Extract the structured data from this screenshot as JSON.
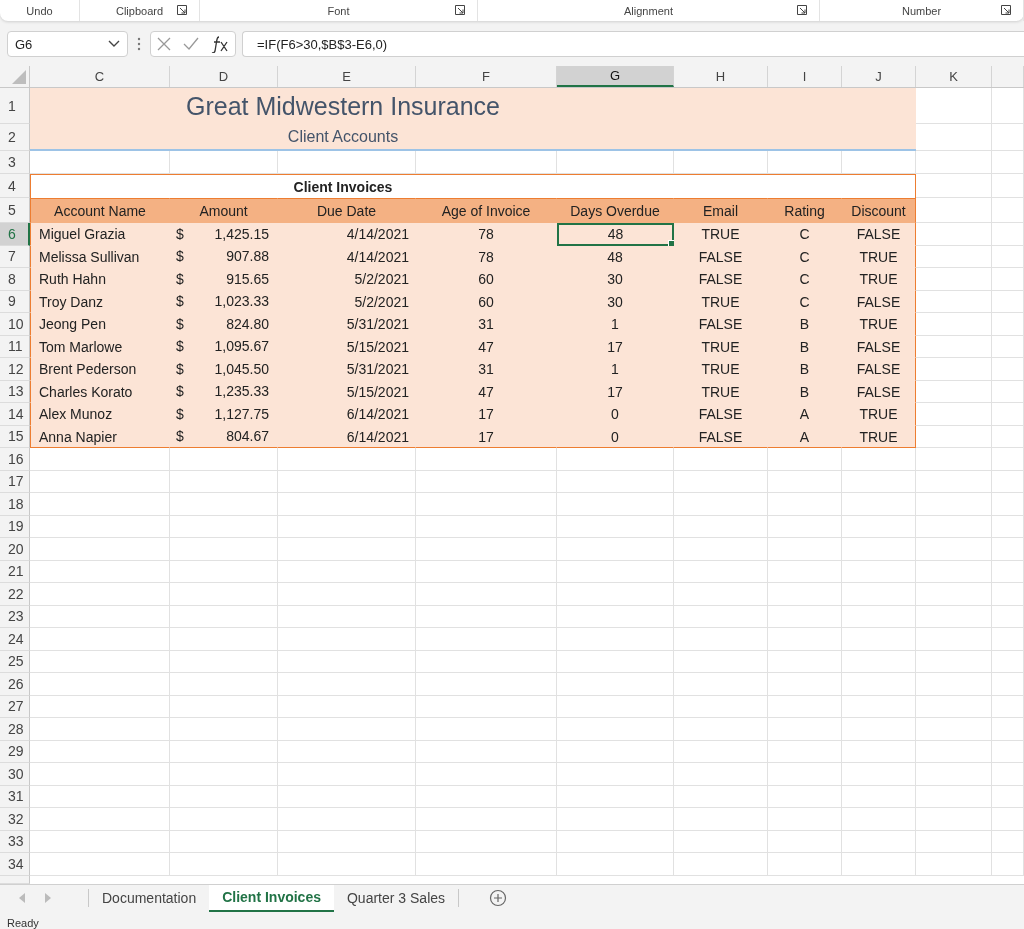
{
  "ribbon_groups": [
    {
      "label": "Undo",
      "launcher": false
    },
    {
      "label": "Clipboard",
      "launcher": true
    },
    {
      "label": "Font",
      "launcher": true
    },
    {
      "label": "Alignment",
      "launcher": true
    },
    {
      "label": "Number",
      "launcher": true
    }
  ],
  "name_box": "G6",
  "formula": "=IF(F6>30,$B$3-E6,0)",
  "columns": [
    {
      "label": "C",
      "selected": false
    },
    {
      "label": "D",
      "selected": false
    },
    {
      "label": "E",
      "selected": false
    },
    {
      "label": "F",
      "selected": false
    },
    {
      "label": "G",
      "selected": true
    },
    {
      "label": "H",
      "selected": false
    },
    {
      "label": "I",
      "selected": false
    },
    {
      "label": "J",
      "selected": false
    },
    {
      "label": "K",
      "selected": false
    }
  ],
  "row_numbers": [
    {
      "label": "1",
      "selected": false
    },
    {
      "label": "2",
      "selected": false
    },
    {
      "label": "3",
      "selected": false
    },
    {
      "label": "4",
      "selected": false
    },
    {
      "label": "5",
      "selected": false
    },
    {
      "label": "6",
      "selected": true
    },
    {
      "label": "7",
      "selected": false
    },
    {
      "label": "8",
      "selected": false
    },
    {
      "label": "9",
      "selected": false
    },
    {
      "label": "10",
      "selected": false
    },
    {
      "label": "11",
      "selected": false
    },
    {
      "label": "12",
      "selected": false
    },
    {
      "label": "13",
      "selected": false
    },
    {
      "label": "14",
      "selected": false
    },
    {
      "label": "15",
      "selected": false
    },
    {
      "label": "16",
      "selected": false
    },
    {
      "label": "17",
      "selected": false
    },
    {
      "label": "18",
      "selected": false
    },
    {
      "label": "19",
      "selected": false
    },
    {
      "label": "20",
      "selected": false
    },
    {
      "label": "21",
      "selected": false
    },
    {
      "label": "22",
      "selected": false
    },
    {
      "label": "23",
      "selected": false
    },
    {
      "label": "24",
      "selected": false
    },
    {
      "label": "25",
      "selected": false
    },
    {
      "label": "26",
      "selected": false
    },
    {
      "label": "27",
      "selected": false
    },
    {
      "label": "28",
      "selected": false
    },
    {
      "label": "29",
      "selected": false
    },
    {
      "label": "30",
      "selected": false
    },
    {
      "label": "31",
      "selected": false
    },
    {
      "label": "32",
      "selected": false
    },
    {
      "label": "33",
      "selected": false
    },
    {
      "label": "34",
      "selected": false
    }
  ],
  "sheet": {
    "title": "Great Midwestern Insurance",
    "subtitle": "Client Accounts",
    "table_title": "Client Invoices",
    "headers": [
      "Account Name",
      "Amount",
      "Due Date",
      "Age of Invoice",
      "Days Overdue",
      "Email",
      "Rating",
      "Discount"
    ],
    "rows": [
      {
        "account_name": "Miguel Grazia",
        "currency": "$",
        "amount": "1,425.15",
        "due_date": "4/14/2021",
        "age_of_invoice": "78",
        "days_overdue": "48",
        "email": "TRUE",
        "rating": "C",
        "discount": "FALSE",
        "days_overdue_active": true
      },
      {
        "account_name": "Melissa Sullivan",
        "currency": "$",
        "amount": "907.88",
        "due_date": "4/14/2021",
        "age_of_invoice": "78",
        "days_overdue": "48",
        "email": "FALSE",
        "rating": "C",
        "discount": "TRUE",
        "days_overdue_active": false
      },
      {
        "account_name": "Ruth Hahn",
        "currency": "$",
        "amount": "915.65",
        "due_date": "5/2/2021",
        "age_of_invoice": "60",
        "days_overdue": "30",
        "email": "FALSE",
        "rating": "C",
        "discount": "TRUE",
        "days_overdue_active": false
      },
      {
        "account_name": "Troy Danz",
        "currency": "$",
        "amount": "1,023.33",
        "due_date": "5/2/2021",
        "age_of_invoice": "60",
        "days_overdue": "30",
        "email": "TRUE",
        "rating": "C",
        "discount": "FALSE",
        "days_overdue_active": false
      },
      {
        "account_name": "Jeong Pen",
        "currency": "$",
        "amount": "824.80",
        "due_date": "5/31/2021",
        "age_of_invoice": "31",
        "days_overdue": "1",
        "email": "FALSE",
        "rating": "B",
        "discount": "TRUE",
        "days_overdue_active": false
      },
      {
        "account_name": "Tom Marlowe",
        "currency": "$",
        "amount": "1,095.67",
        "due_date": "5/15/2021",
        "age_of_invoice": "47",
        "days_overdue": "17",
        "email": "TRUE",
        "rating": "B",
        "discount": "FALSE",
        "days_overdue_active": false
      },
      {
        "account_name": "Brent Pederson",
        "currency": "$",
        "amount": "1,045.50",
        "due_date": "5/31/2021",
        "age_of_invoice": "31",
        "days_overdue": "1",
        "email": "TRUE",
        "rating": "B",
        "discount": "FALSE",
        "days_overdue_active": false
      },
      {
        "account_name": "Charles Korato",
        "currency": "$",
        "amount": "1,235.33",
        "due_date": "5/15/2021",
        "age_of_invoice": "47",
        "days_overdue": "17",
        "email": "TRUE",
        "rating": "B",
        "discount": "FALSE",
        "days_overdue_active": false
      },
      {
        "account_name": "Alex Munoz",
        "currency": "$",
        "amount": "1,127.75",
        "due_date": "6/14/2021",
        "age_of_invoice": "17",
        "days_overdue": "0",
        "email": "FALSE",
        "rating": "A",
        "discount": "TRUE",
        "days_overdue_active": false
      },
      {
        "account_name": "Anna Napier",
        "currency": "$",
        "amount": "804.67",
        "due_date": "6/14/2021",
        "age_of_invoice": "17",
        "days_overdue": "0",
        "email": "FALSE",
        "rating": "A",
        "discount": "TRUE",
        "days_overdue_active": false
      }
    ]
  },
  "sheet_tabs": [
    {
      "label": "Documentation",
      "selected": false
    },
    {
      "label": "Client Invoices",
      "selected": true
    },
    {
      "label": "Quarter 3 Sales",
      "selected": false
    }
  ],
  "status": "Ready"
}
